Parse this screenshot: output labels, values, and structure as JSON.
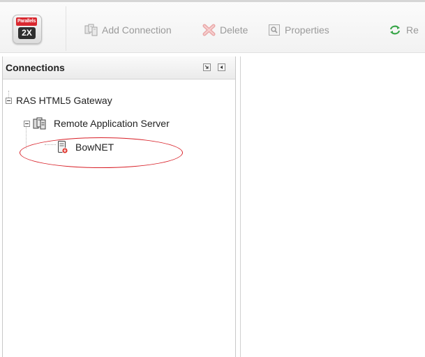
{
  "toolbar": {
    "logo": {
      "brand_text": "Parallels",
      "badge": "2X",
      "brand_color": "#d9282f"
    },
    "buttons": [
      {
        "label": "Add Connection",
        "icon": "add-connection-icon"
      },
      {
        "label": "Delete",
        "icon": "delete-icon"
      },
      {
        "label": "Properties",
        "icon": "properties-icon"
      },
      {
        "label": "Re",
        "icon": "refresh-icon"
      }
    ]
  },
  "panel": {
    "title": "Connections",
    "header_icons": [
      "pin-icon",
      "collapse-panel-icon"
    ]
  },
  "tree": {
    "root": {
      "label": "RAS HTML5 Gateway",
      "expanded": true
    },
    "server": {
      "label": "Remote Application Server",
      "icon": "servers-icon",
      "expanded": true
    },
    "connection": {
      "label": "BowNET",
      "icon": "connection-server-icon"
    }
  },
  "annotation": {
    "shape": "ellipse",
    "color": "#d81e26",
    "target": "BowNET"
  },
  "colors": {
    "toolbar_text_disabled": "#9a9a9a",
    "refresh_green": "#3aa64a"
  }
}
